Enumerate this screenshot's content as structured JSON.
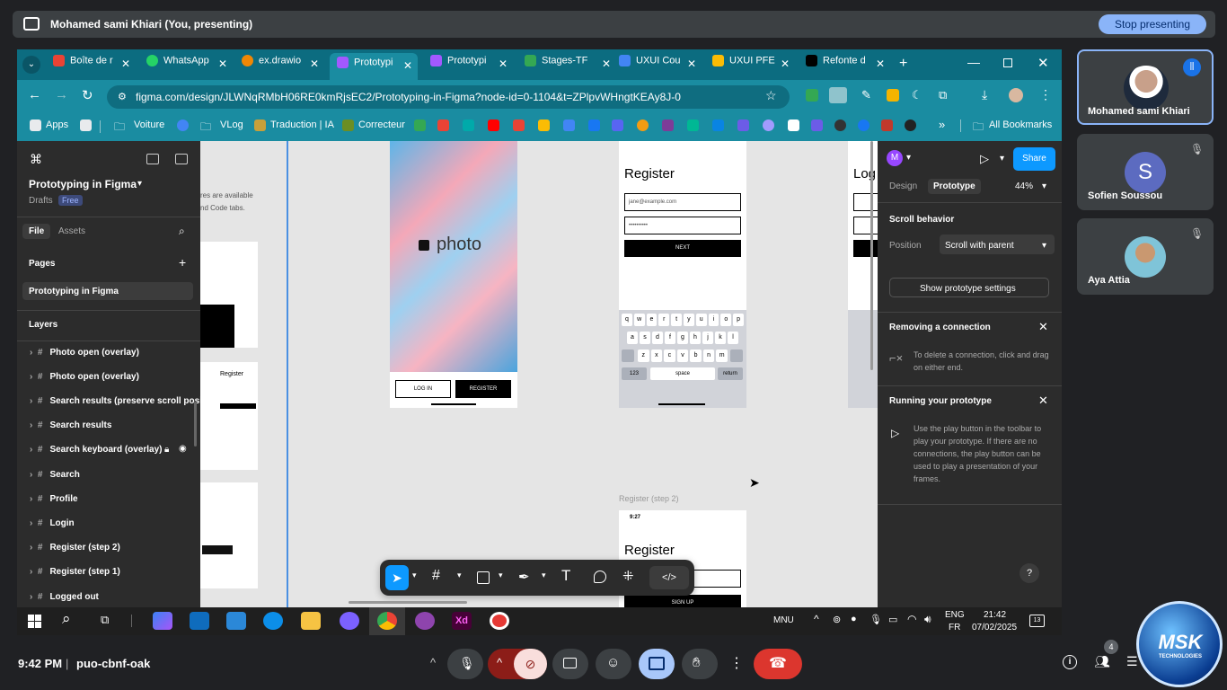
{
  "presenting_bar": {
    "title": "Mohamed sami Khiari (You, presenting)",
    "stop_label": "Stop presenting"
  },
  "tabs": [
    {
      "label": "Boîte de r",
      "color": "#ea4335"
    },
    {
      "label": "WhatsApp",
      "color": "#25d366"
    },
    {
      "label": "ex.drawio",
      "color": "#f08705"
    },
    {
      "label": "Prototypi",
      "color": "#a259ff",
      "active": true
    },
    {
      "label": "Prototypi",
      "color": "#a259ff"
    },
    {
      "label": "Stages-TF",
      "color": "#34a853"
    },
    {
      "label": "UXUI Cou",
      "color": "#4285f4"
    },
    {
      "label": "UXUI PFE",
      "color": "#fbbc04"
    },
    {
      "label": "Refonte d",
      "color": "#000000"
    }
  ],
  "url": "figma.com/design/JLWNqRMbH06RE0kmRjsEC2/Prototyping-in-Figma?node-id=0-1104&t=ZPlpvWHngtKEAy8J-0",
  "bookmarks": {
    "apps": "Apps",
    "voiture": "Voiture",
    "vlog": "VLog",
    "traduction": "Traduction | IA",
    "correcteur": "Correcteur",
    "all": "All Bookmarks"
  },
  "figma_left": {
    "file_title": "Prototyping in Figma",
    "drafts": "Drafts",
    "free_badge": "Free",
    "tab_file": "File",
    "tab_assets": "Assets",
    "pages_label": "Pages",
    "page_item": "Prototyping in Figma",
    "layers_label": "Layers",
    "layers": [
      "Photo open (overlay)",
      "Photo open (overlay)",
      "Search results (preserve scroll positi",
      "Search results",
      "Search keyboard (overlay)",
      "Search",
      "Profile",
      "Login",
      "Register (step 2)",
      "Register (step 1)",
      "Logged out"
    ]
  },
  "canvas": {
    "hint_text_1": "res are available",
    "hint_text_2": "nd Code tabs.",
    "photo_logo": "photo",
    "login_btn": "LOG IN",
    "register_btn": "REGISTER",
    "register_title": "Register",
    "email_placeholder": "jane@example.com",
    "password_dots": "••••••••••",
    "next_btn": "NEXT",
    "frame_label": "Register (step 2)",
    "time": "9:27",
    "register_title_2": "Register",
    "signup_btn": "SIGN UP",
    "log_partial": "Log",
    "keyboard_row1": [
      "q",
      "w",
      "e",
      "r",
      "t",
      "y",
      "u",
      "i",
      "o",
      "p"
    ],
    "keyboard_row2": [
      "a",
      "s",
      "d",
      "f",
      "g",
      "h",
      "j",
      "k",
      "l"
    ],
    "keyboard_row3": [
      "z",
      "x",
      "c",
      "v",
      "b",
      "n",
      "m"
    ],
    "key_123": "123",
    "key_space": "space",
    "key_return": "return"
  },
  "figma_right": {
    "avatar_letter": "M",
    "share": "Share",
    "tab_design": "Design",
    "tab_prototype": "Prototype",
    "zoom": "44%",
    "scroll_behavior": "Scroll behavior",
    "position_label": "Position",
    "position_value": "Scroll with parent",
    "show_settings": "Show prototype settings",
    "removing_title": "Removing a connection",
    "removing_text": "To delete a connection, click and drag on either end.",
    "running_title": "Running your prototype",
    "running_text": "Use the play button in the toolbar to play your prototype. If there are no connections, the play button can be used to play a presentation of your frames.",
    "help": "?"
  },
  "taskbar": {
    "lang1": "MNU",
    "lang2": "ENG",
    "lang3": "FR",
    "time": "21:42",
    "date": "07/02/2025",
    "notif": "13"
  },
  "participants": [
    {
      "name": "Mohamed sami Khiari"
    },
    {
      "name": "Sofien Soussou",
      "initial": "S"
    },
    {
      "name": "Aya Attia"
    }
  ],
  "bottom": {
    "time": "9:42 PM",
    "separator": "|",
    "meeting_code": "puo-cbnf-oak",
    "people_count": "4"
  },
  "logo": {
    "brand": "MSK",
    "sub": "TECHNOLOGIES"
  }
}
